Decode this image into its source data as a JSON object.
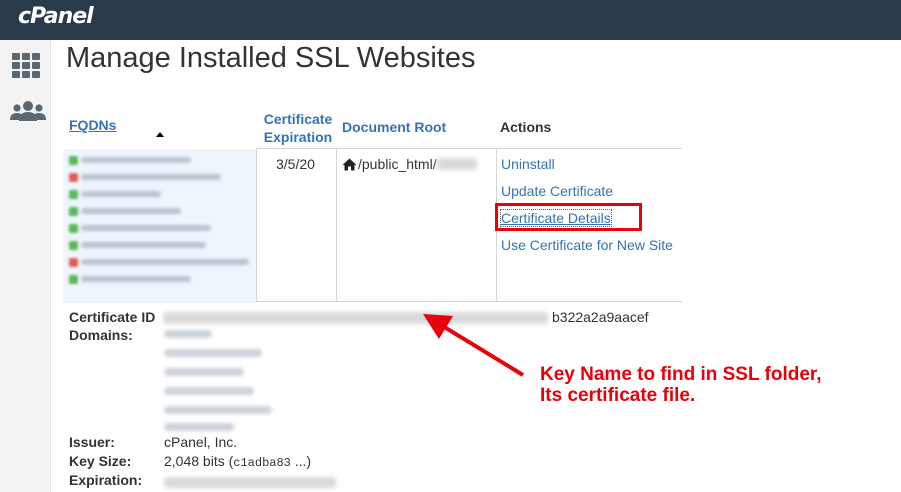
{
  "app": {
    "logo": "cPanel"
  },
  "sidebar": {
    "items": [
      {
        "icon": "grid-icon"
      },
      {
        "icon": "users-icon"
      }
    ]
  },
  "page": {
    "title": "Manage Installed SSL Websites"
  },
  "table": {
    "headers": {
      "fqdns": "FQDNs",
      "expiration_line1": "Certificate",
      "expiration_line2": "Expiration",
      "document_root": "Document Root",
      "actions": "Actions"
    },
    "row": {
      "expiration": "3/5/20",
      "document_root": "/public_html/",
      "actions": [
        "Uninstall",
        "Update Certificate",
        "Certificate Details",
        "Use Certificate for New Site"
      ]
    }
  },
  "details": {
    "certificate_id_label": "Certificate ID",
    "certificate_id_suffix": "b322a2a9aacef",
    "domains_label": "Domains:",
    "issuer_label": "Issuer:",
    "issuer_value": "cPanel, Inc.",
    "key_size_label": "Key Size:",
    "key_size_value": "2,048 bits (",
    "key_size_mono": "c1adba83",
    "key_size_tail": " ...)",
    "expiration_label": "Expiration:"
  },
  "annotation": {
    "line1": "Key Name to find in SSL folder,",
    "line2": "Its certificate file."
  },
  "colors": {
    "topbar": "#293a4a",
    "link": "#3573b5",
    "highlight": "#e8000b",
    "fqdn_ok": "#5cb85c",
    "fqdn_warn": "#e05a5a"
  }
}
